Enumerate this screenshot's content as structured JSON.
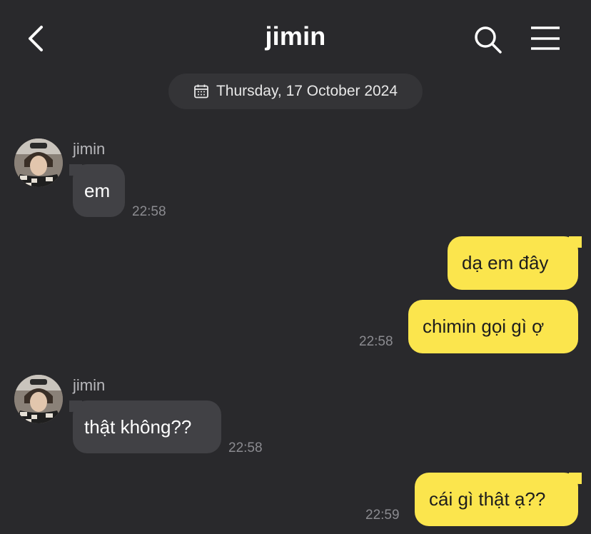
{
  "header": {
    "title": "jimin",
    "back_icon": "chevron-left-icon",
    "search_icon": "search-icon",
    "menu_icon": "hamburger-menu-icon"
  },
  "date_divider": {
    "icon": "calendar-icon",
    "label": "Thursday, 17 October 2024"
  },
  "messages": [
    {
      "direction": "incoming",
      "sender": "jimin",
      "text": "em",
      "time": "22:58"
    },
    {
      "direction": "outgoing",
      "text": "dạ em đây"
    },
    {
      "direction": "outgoing",
      "text": "chimin gọi gì ợ",
      "time": "22:58"
    },
    {
      "direction": "incoming",
      "sender": "jimin",
      "text": "thật không??",
      "time": "22:58"
    },
    {
      "direction": "outgoing",
      "text": "cái gì thật ạ??",
      "time": "22:59"
    }
  ],
  "colors": {
    "background": "#29292c",
    "incoming_bubble": "#414145",
    "outgoing_bubble": "#fbe54d",
    "timestamp": "#8b8b90"
  }
}
